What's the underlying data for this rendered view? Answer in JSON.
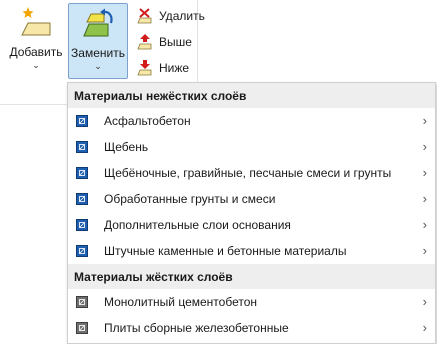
{
  "ribbon": {
    "add_label": "Добавить",
    "replace_label": "Заменить",
    "delete_label": "Удалить",
    "up_label": "Выше",
    "down_label": "Ниже",
    "icons": {
      "add": "layer-add-icon",
      "replace": "layer-replace-icon",
      "delete": "layer-delete-icon",
      "up": "layer-up-icon",
      "down": "layer-down-icon"
    }
  },
  "menu": {
    "group_flexible": {
      "title": "Материалы нежёстких слоёв",
      "items": [
        {
          "label": "Асфальтобетон"
        },
        {
          "label": "Щебень"
        },
        {
          "label": "Щебёночные, гравийные, песчаные смеси и грунты"
        },
        {
          "label": "Обработанные грунты и смеси"
        },
        {
          "label": "Дополнительные слои основания"
        },
        {
          "label": "Штучные каменные и бетонные материалы"
        }
      ]
    },
    "group_rigid": {
      "title": "Материалы жёстких слоёв",
      "items": [
        {
          "label": "Монолитный цементобетон"
        },
        {
          "label": "Плиты сборные железобетонные"
        }
      ]
    },
    "submenu_arrow": "›"
  },
  "colors": {
    "accent_selected_bg": "#cde6f7",
    "accent_selected_border": "#7da2ce",
    "flexible_icon": "#1f5fb0",
    "rigid_icon": "#6f6f6f",
    "header_bg": "#eeeeee"
  }
}
